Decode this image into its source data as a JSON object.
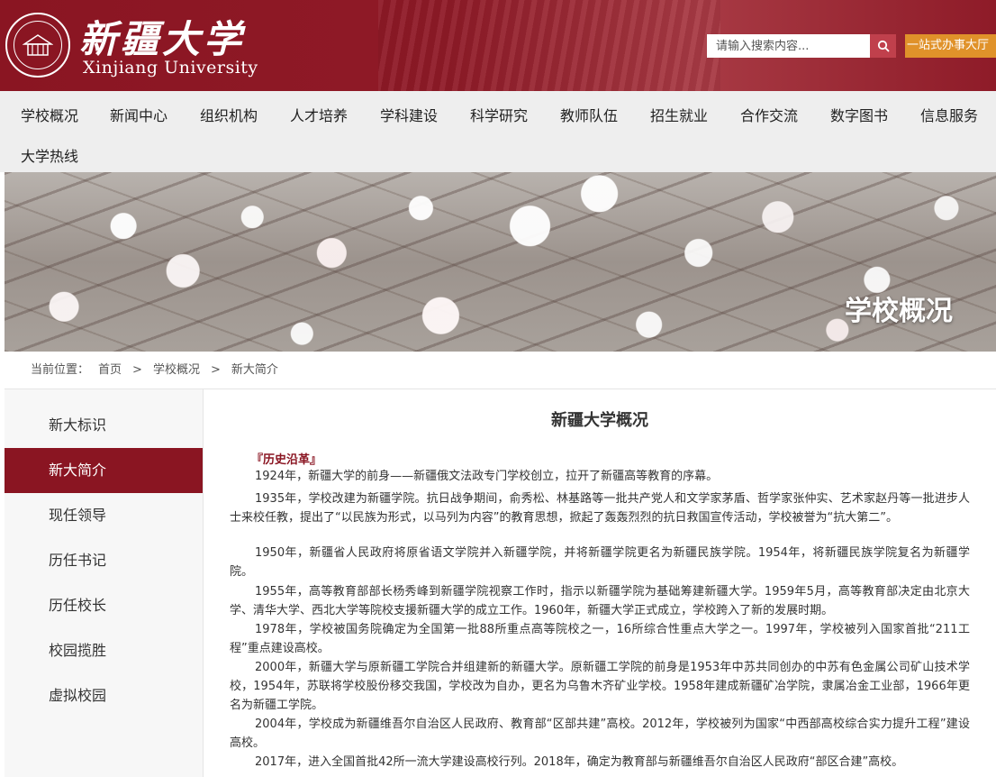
{
  "header": {
    "logo_cn": "新疆大学",
    "logo_en": "Xinjiang University",
    "search_placeholder": "请输入搜索内容...",
    "service_button": "一站式办事大厅"
  },
  "nav": {
    "items": [
      "学校概况",
      "新闻中心",
      "组织机构",
      "人才培养",
      "学科建设",
      "科学研究",
      "教师队伍",
      "招生就业",
      "合作交流",
      "数字图书",
      "信息服务",
      "大学热线"
    ]
  },
  "banner": {
    "title": "学校概况"
  },
  "breadcrumb": {
    "prefix": "当前位置：",
    "items": [
      "首页",
      "学校概况",
      "新大简介"
    ],
    "separator": ">"
  },
  "sidebar": {
    "items": [
      "新大标识",
      "新大简介",
      "现任领导",
      "历任书记",
      "历任校长",
      "校园揽胜",
      "虚拟校园"
    ],
    "active_index": 1
  },
  "article": {
    "title": "新疆大学概况",
    "section_head": "『历史沿革』",
    "paragraphs": [
      "1924年，新疆大学的前身——新疆俄文法政专门学校创立，拉开了新疆高等教育的序幕。",
      "1935年，学校改建为新疆学院。抗日战争期间，俞秀松、林基路等一批共产党人和文学家茅盾、哲学家张仲实、艺术家赵丹等一批进步人士来校任教，提出了“以民族为形式，以马列为内容”的教育思想，掀起了轰轰烈烈的抗日救国宣传活动，学校被誉为“抗大第二”。",
      "1950年，新疆省人民政府将原省语文学院并入新疆学院，并将新疆学院更名为新疆民族学院。1954年，将新疆民族学院复名为新疆学院。",
      "1955年，高等教育部部长杨秀峰到新疆学院视察工作时，指示以新疆学院为基础筹建新疆大学。1959年5月，高等教育部决定由北京大学、清华大学、西北大学等院校支援新疆大学的成立工作。1960年，新疆大学正式成立，学校跨入了新的发展时期。",
      "1978年，学校被国务院确定为全国第一批88所重点高等院校之一，16所综合性重点大学之一。1997年，学校被列入国家首批“211工程”重点建设高校。",
      "2000年，新疆大学与原新疆工学院合并组建新的新疆大学。原新疆工学院的前身是1953年中苏共同创办的中苏有色金属公司矿山技术学校，1954年，苏联将学校股份移交我国，学校改为自办，更名为乌鲁木齐矿业学校。1958年建成新疆矿冶学院，隶属冶金工业部，1966年更名为新疆工学院。",
      "2004年，学校成为新疆维吾尔自治区人民政府、教育部“区部共建”高校。2012年，学校被列为国家“中西部高校综合实力提升工程”建设高校。",
      "2017年，进入全国首批42所一流大学建设高校行列。2018年，确定为教育部与新疆维吾尔自治区人民政府“部区合建”高校。"
    ]
  },
  "colors": {
    "brand": "#8a1522",
    "service_button": "#e0922a",
    "search_button": "#c0404c"
  },
  "icons": {
    "search": "search-icon",
    "emblem": "university-emblem-icon"
  }
}
